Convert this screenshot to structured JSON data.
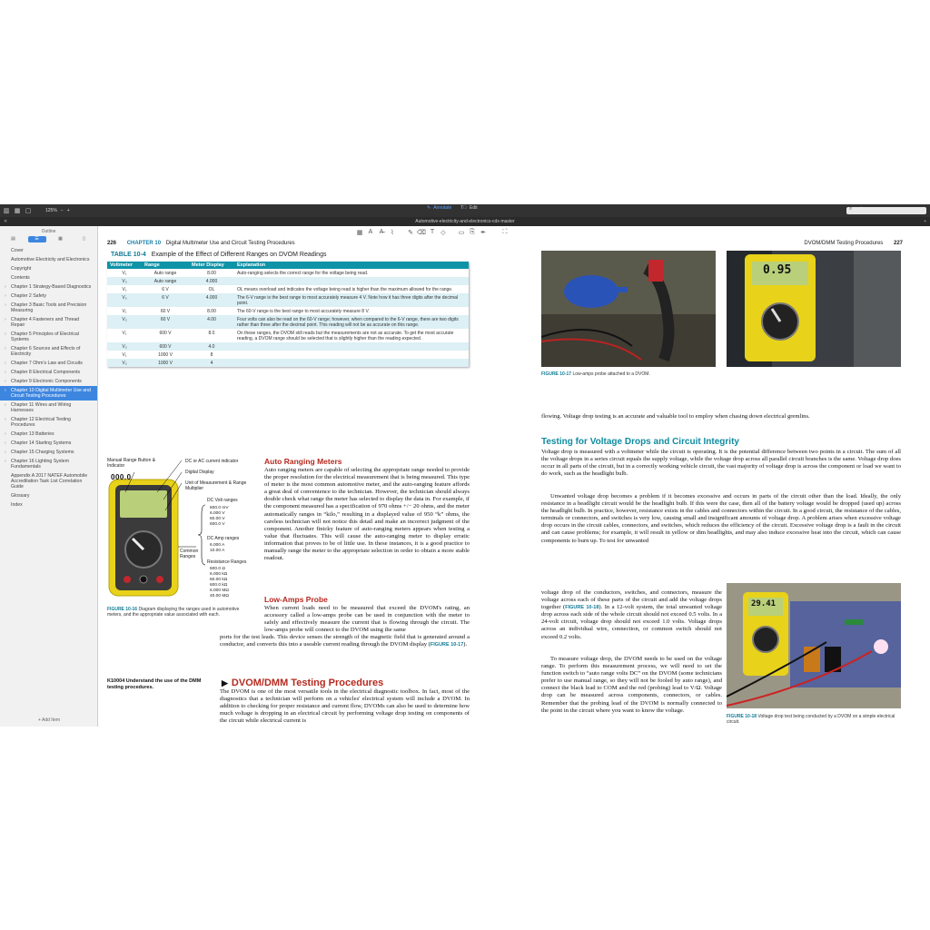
{
  "toolbar": {
    "zoom": "125%",
    "zoom_out": "−",
    "zoom_in": "+",
    "mode_annotate": "Annotate",
    "mode_edit": "Edit",
    "search_placeholder": ""
  },
  "title": "Automotive-electricity-and-electronics-cdx-master",
  "sidebar": {
    "header": "Outline",
    "add_item": "+ Add Item",
    "items": [
      {
        "label": "Cover",
        "chev": false
      },
      {
        "label": "Automotive Electricity and Electronics",
        "chev": false
      },
      {
        "label": "Copyright",
        "chev": false
      },
      {
        "label": "Contents",
        "chev": false
      },
      {
        "label": "Chapter 1 Strategy-Based Diagnostics",
        "chev": true
      },
      {
        "label": "Chapter 2 Safety",
        "chev": true
      },
      {
        "label": "Chapter 3 Basic Tools and Precision Measuring",
        "chev": true
      },
      {
        "label": "Chapter 4 Fasteners and Thread Repair",
        "chev": true
      },
      {
        "label": "Chapter 5 Principles of Electrical Systems",
        "chev": true
      },
      {
        "label": "Chapter 6 Sources and Effects of Electricity",
        "chev": true
      },
      {
        "label": "Chapter 7 Ohm's Law and Circuits",
        "chev": true
      },
      {
        "label": "Chapter 8 Electrical Components",
        "chev": true
      },
      {
        "label": "Chapter 9 Electronic Components",
        "chev": true
      },
      {
        "label": "Chapter 10 Digital Multimeter Use and Circuit Testing Procedures",
        "chev": true,
        "active": true
      },
      {
        "label": "Chapter 11 Wires and Wiring Harnesses",
        "chev": true
      },
      {
        "label": "Chapter 12 Electrical Testing Procedures",
        "chev": true
      },
      {
        "label": "Chapter 13 Batteries",
        "chev": true
      },
      {
        "label": "Chapter 14 Starting Systems",
        "chev": true
      },
      {
        "label": "Chapter 15 Charging Systems",
        "chev": true
      },
      {
        "label": "Chapter 16 Lighting System Fundamentals",
        "chev": true
      },
      {
        "label": "Appendix A 2017 NATEF Automobile Accreditation Task List Correlation Guide",
        "chev": false
      },
      {
        "label": "Glossary",
        "chev": false
      },
      {
        "label": "Index",
        "chev": false
      }
    ]
  },
  "left_page": {
    "page_number": "226",
    "chapter_label": "CHAPTER 10",
    "chapter_title": "Digital Multimeter Use and Circuit Testing Procedures",
    "table_label": "TABLE 10-4",
    "table_title": "Example of the Effect of Different Ranges on DVOM Readings",
    "table_headers": [
      "Voltmeter",
      "Range",
      "Meter Display",
      "Explanation"
    ],
    "table_rows": [
      {
        "v": "V₁",
        "range": "Auto range",
        "display": "8.00",
        "exp": "Auto-ranging selects the correct range for the voltage being read."
      },
      {
        "v": "V₂",
        "range": "Auto range",
        "display": "4.000",
        "exp": ""
      },
      {
        "v": "V₁",
        "range": "6 V",
        "display": "OL",
        "exp": "OL means overload and indicates the voltage being read is higher than the maximum allowed for the range."
      },
      {
        "v": "V₂",
        "range": "6 V",
        "display": "4.000",
        "exp": "The 6-V range is the best range to most accurately measure 4 V. Note how it has three digits after the decimal point."
      },
      {
        "v": "V₁",
        "range": "60 V",
        "display": "8.00",
        "exp": "The 60-V range is the best range to most accurately measure 8 V."
      },
      {
        "v": "V₂",
        "range": "60 V",
        "display": "4.00",
        "exp": "Four volts can also be read on the 60-V range; however, when compared to the 6-V range, there are two digits rather than three after the decimal point. This reading will not be as accurate on this range."
      },
      {
        "v": "V₁",
        "range": "600 V",
        "display": "8.0",
        "exp": "On these ranges, the DVOM still reads but the measurements are not as accurate. To get the most accurate reading, a DVOM range should be selected that is slightly higher than the reading expected."
      },
      {
        "v": "V₂",
        "range": "600 V",
        "display": "4.0",
        "exp": ""
      },
      {
        "v": "V₁",
        "range": "1000 V",
        "display": "8",
        "exp": ""
      },
      {
        "v": "V₂",
        "range": "1000 V",
        "display": "4",
        "exp": ""
      }
    ],
    "fig16": {
      "labels": {
        "manual": "Manual Range Button & Indicator",
        "acdc": "DC or AC current indicator",
        "digital": "Digital Display",
        "unit": "Unit of Measurement & Range Multiplier",
        "common": "Common Ranges",
        "dcv_title": "DC Volt ranges",
        "dca_title": "DC Amp ranges",
        "res_title": "Resistance Ranges",
        "screen": "000.0"
      },
      "dcv": [
        "600.0 mV",
        "6.000 V",
        "60.00 V",
        "600.0 V"
      ],
      "dca": [
        "6.000 A",
        "10.00 A"
      ],
      "res": [
        "600.0 Ω",
        "6.000 kΩ",
        "60.00 kΩ",
        "600.0 kΩ",
        "6.000 MΩ",
        "40.00 MΩ"
      ],
      "caption_label": "FIGURE 10-16",
      "caption": "Diagram displaying the ranges used in automotive meters, and the appropriate value associated with each."
    },
    "auto_heading": "Auto Ranging Meters",
    "auto_text": "Auto ranging meters are capable of selecting the appropriate range needed to provide the proper resolution for the electrical measurement that is being measured. This type of meter is the most common automotive meter, and the auto-ranging feature affords a great deal of convenience to the technician. However, the technician should always double check what range the meter has selected to display the data in. For example, if the component measured has a specification of 970 ohms +/− 20 ohms, and the meter automatically ranges in “kilo,” resulting in a displayed value of 950 “k” ohms, the careless technician will not notice this detail and make an incorrect judgment of the component. Another finicky feature of auto-ranging meters appears when testing a value that fluctuates. This will cause the auto-ranging meter to display erratic information that proves to be of little use. In these instances, it is a good practice to manually range the meter to the appropriate selection in order to obtain a more stable readout.",
    "lowamp_heading": "Low-Amps Probe",
    "lowamp_text_a": "When current loads need to be measured that exceed the DVOM's rating, an accessory called a low-amps probe can be used in conjunction with the meter to safely and effectively measure the current that is flowing through the circuit. The low-amps probe will connect to the DVOM using the same",
    "lowamp_text_b": "ports for the test leads. This device senses the strength of the magnetic field that is generated around a conductor, and converts this into a useable current reading through the DVOM display (",
    "lowamp_ref": "FIGURE 10-17",
    "lowamp_end": ").",
    "objective": "K10004 Understand the use of the DMM testing procedures.",
    "section_heading": "DVOM/DMM Testing Procedures",
    "section_text": "The DVOM is one of the most versatile tools in the electrical diagnostic toolbox. In fact, most of the diagnostics that a technician will perform on a vehicles' electrical system will include a DVOM. In addition to checking for proper resistance and current flow, DVOMs can also be used to determine how much voltage is dropping in an electrical circuit by performing voltage drop testing on components of the circuit while electrical current is"
  },
  "right_page": {
    "page_number": "227",
    "running_title": "DVOM/DMM Testing Procedures",
    "fig17_label": "FIGURE 10-17",
    "fig17_caption": "Low-amps probe attached to a DVOM.",
    "fig17b_screen": "0.95",
    "intro": "flowing. Voltage drop testing is an accurate and valuable tool to employ when chasing down electrical gremlins.",
    "heading": "Testing for Voltage Drops and Circuit Integrity",
    "para1": "Voltage drop is measured with a voltmeter while the circuit is operating. It is the potential difference between two points in a circuit. The sum of all the voltage drops in a series circuit equals the supply voltage, while the voltage drop across all parallel circuit branches is the same. Voltage drop does occur in all parts of the circuit, but in a correctly working vehicle circuit, the vast majority of voltage drop is across the component or load we want to do work, such as the headlight bulb.",
    "para2a": "Unwanted voltage drop becomes a problem if it becomes excessive and occurs in parts of the circuit other than the load. Ideally, the only resistance in a headlight circuit would be the headlight bulb. If this were the case, then all of the battery voltage would be dropped (used up) across the headlight bulb. In practice, however, resistance exists in the cables and connectors within the circuit. In a good circuit, the resistance of the cables, terminals or connectors, and switches is very low, causing small and insignificant amounts of voltage drop. A problem arises when excessive voltage drop occurs in the circuit cables, connectors, and switches, which reduces the efficiency of the circuit. Excessive voltage drop is a fault in the circuit and can cause problems; for example, it will result in yellow or dim headlights, and may also induce excessive heat into the circuit, which can cause components to burn up. To test for unwanted",
    "para2b": "voltage drop of the conductors, switches, and connectors, measure the voltage across each of these parts of the circuit and add the voltage drops together (",
    "para2_ref": "FIGURE 10-18",
    "para2c": "). In a 12-volt system, the total unwanted voltage drop across each side of the whole circuit should not exceed 0.5 volts. In a 24-volt circuit, voltage drop should not exceed 1.0 volts. Voltage drops across an individual wire, connection, or common switch should not exceed 0.2 volts.",
    "para3": "To measure voltage drop, the DVOM needs to be used on the voltage range. To perform this measurement process, we will need to set the function switch to “auto range volts DC” on the DVOM (some technicians prefer to use manual range, so they will not be fooled by auto range), and connect the black lead to COM and the red (probing) lead to V/Ω. Voltage drop can be measured across components, connectors, or cables. Remember that the probing lead of the DVOM is normally connected to the point in the circuit where you want to know the voltage.",
    "fig18_label": "FIGURE 10-18",
    "fig18_caption": "Voltage drop test being conducted by a DVOM on a simple electrical circuit.",
    "fig18_screen": "29.41"
  },
  "colors": {
    "accent": "#3d86e0",
    "teal": "#0f93a7",
    "red_heading": "#b52a1f"
  }
}
